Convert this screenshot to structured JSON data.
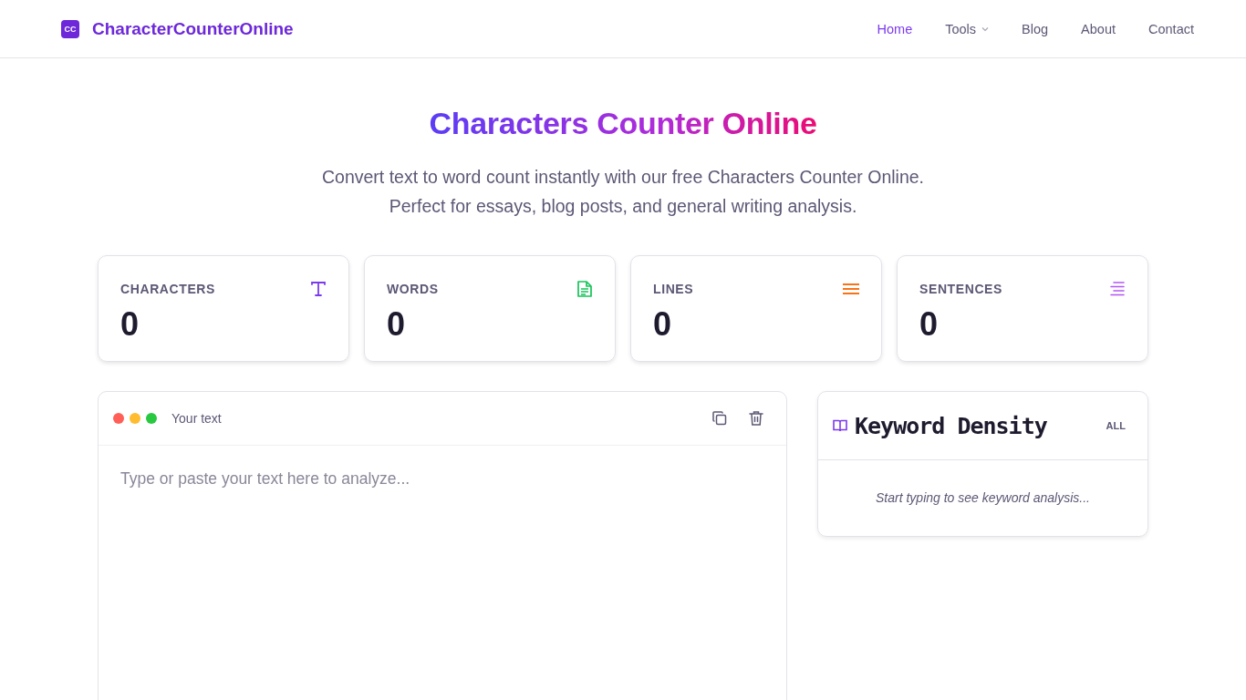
{
  "header": {
    "logo_badge": "CC",
    "logo_text": "CharacterCounterOnline",
    "nav": [
      {
        "label": "Home",
        "selected": true,
        "dropdown": false
      },
      {
        "label": "Tools",
        "selected": false,
        "dropdown": true
      },
      {
        "label": "Blog",
        "selected": false,
        "dropdown": false
      },
      {
        "label": "About",
        "selected": false,
        "dropdown": false
      },
      {
        "label": "Contact",
        "selected": false,
        "dropdown": false
      }
    ]
  },
  "hero": {
    "title": "Characters Counter Online",
    "subtitle_lines": [
      "Convert text to word count instantly with our free Characters Counter Online.",
      "Perfect for essays, blog posts, and general writing analysis."
    ]
  },
  "stats": [
    {
      "label": "CHARACTERS",
      "value": "0",
      "kind": "characters"
    },
    {
      "label": "WORDS",
      "value": "0",
      "kind": "words"
    },
    {
      "label": "LINES",
      "value": "0",
      "kind": "lines"
    },
    {
      "label": "SENTENCES",
      "value": "0",
      "kind": "sentences"
    }
  ],
  "editor": {
    "title": "Your text",
    "placeholder": "Type or paste your text here to analyze..."
  },
  "keyword_density": {
    "title": "Keyword Density",
    "filter": "ALL",
    "empty_message": "Start typing to see keyword analysis..."
  }
}
